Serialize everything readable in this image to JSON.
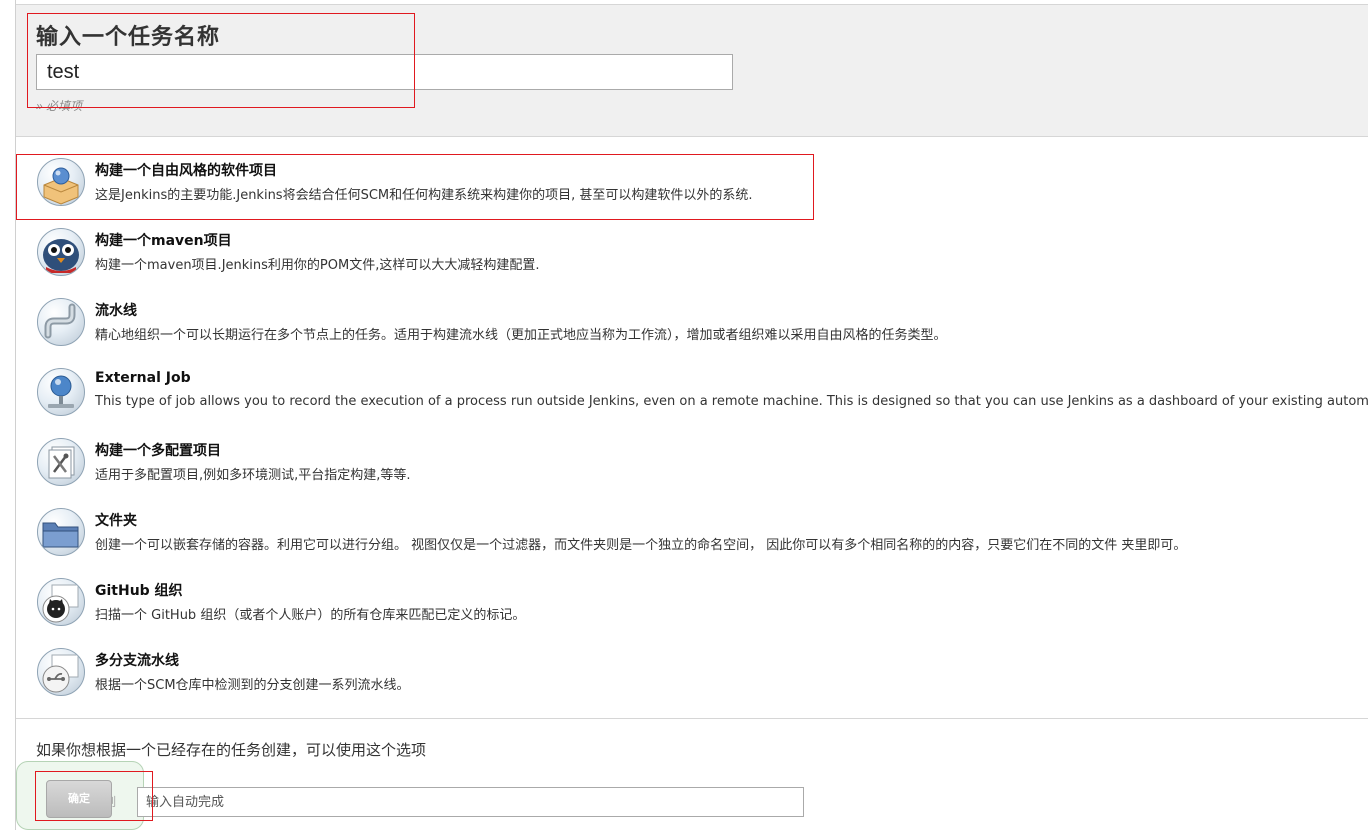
{
  "name_section": {
    "title": "输入一个任务名称",
    "input_value": "test",
    "required_hint": "» 必填项"
  },
  "item_types": [
    {
      "title": "构建一个自由风格的软件项目",
      "description": "这是Jenkins的主要功能.Jenkins将会结合任何SCM和任何构建系统来构建你的项目, 甚至可以构建软件以外的系统.",
      "icon": "freestyle-project-icon"
    },
    {
      "title": "构建一个maven项目",
      "description": "构建一个maven项目.Jenkins利用你的POM文件,这样可以大大减轻构建配置.",
      "icon": "maven-project-icon"
    },
    {
      "title": "流水线",
      "description": "精心地组织一个可以长期运行在多个节点上的任务。适用于构建流水线（更加正式地应当称为工作流），增加或者组织难以采用自由风格的任务类型。",
      "icon": "pipeline-icon"
    },
    {
      "title": "External Job",
      "description": "This type of job allows you to record the execution of a process run outside Jenkins, even on a remote machine. This is designed so that you can use Jenkins as a dashboard of your existing automation syst",
      "icon": "external-job-icon"
    },
    {
      "title": "构建一个多配置项目",
      "description": "适用于多配置项目,例如多环境测试,平台指定构建,等等.",
      "icon": "multi-config-project-icon"
    },
    {
      "title": "文件夹",
      "description": "创建一个可以嵌套存储的容器。利用它可以进行分组。 视图仅仅是一个过滤器，而文件夹则是一个独立的命名空间， 因此你可以有多个相同名称的的内容，只要它们在不同的文件 夹里即可。",
      "icon": "folder-icon"
    },
    {
      "title": "GitHub 组织",
      "description": "扫描一个 GitHub 组织（或者个人账户）的所有仓库来匹配已定义的标记。",
      "icon": "github-organization-icon"
    },
    {
      "title": "多分支流水线",
      "description": "根据一个SCM仓库中检测到的分支创建一系列流水线。",
      "icon": "multibranch-pipeline-icon"
    }
  ],
  "copy_section": {
    "hint": "如果你想根据一个已经存在的任务创建，可以使用这个选项",
    "copy_label": "复制",
    "input_placeholder": "输入自动完成",
    "ok_label": "确定"
  },
  "colors": {
    "highlight_border": "#e0191f",
    "panel_background": "#f0f0f0"
  }
}
